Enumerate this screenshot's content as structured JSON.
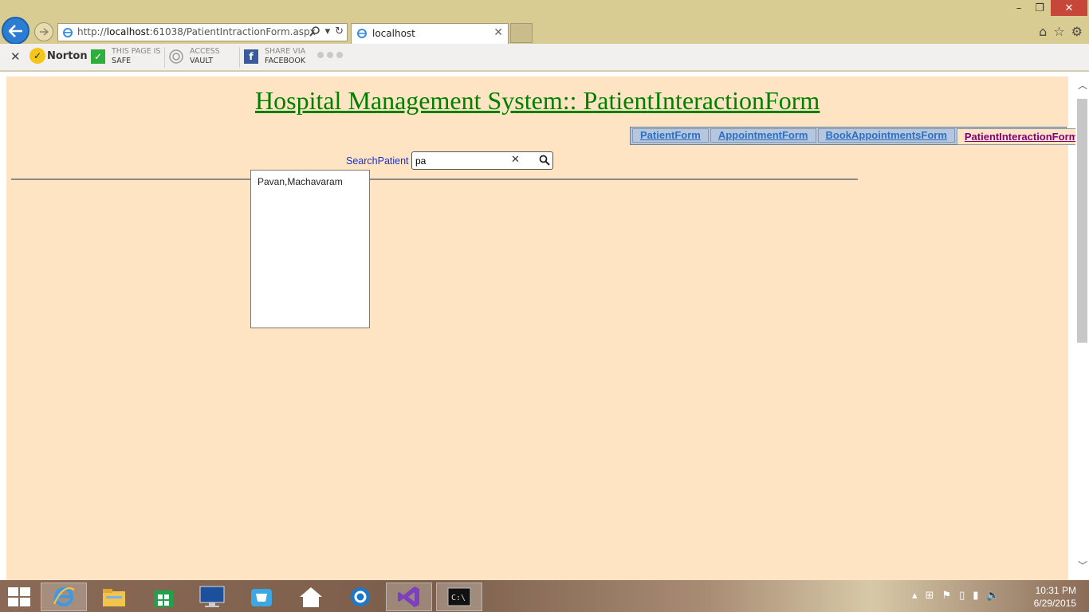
{
  "browser": {
    "url_prefix": "http://",
    "url_host": "localhost",
    "url_rest": ":61038/PatientIntractionForm.aspx",
    "tab_title": "localhost",
    "close_window": "✕",
    "minimize": "–",
    "restore": "❐"
  },
  "toolbar": {
    "brand": "Norton",
    "safe_line1": "THIS PAGE IS",
    "safe_line2": "SAFE",
    "vault_line1": "ACCESS",
    "vault_line2": "VAULT",
    "share_line1": "SHARE VIA",
    "share_line2": "FACEBOOK"
  },
  "page": {
    "title": "Hospital Management System:: PatientInteractionForm",
    "menu": [
      {
        "label": "PatientForm",
        "active": false
      },
      {
        "label": "AppointmentForm",
        "active": false
      },
      {
        "label": "BookAppointmentsForm",
        "active": false
      },
      {
        "label": "PatientInteractionForm",
        "active": true
      }
    ],
    "search_label": "SearchPatient",
    "search_value": "pa",
    "suggestions": [
      "Pavan,Machavaram"
    ]
  },
  "taskbar": {
    "time": "10:31 PM",
    "date": "6/29/2015",
    "apps": [
      "internet-explorer",
      "file-explorer",
      "store",
      "lenovo",
      "mail",
      "home",
      "browser-alt",
      "visual-studio",
      "command-prompt"
    ]
  },
  "colors": {
    "page_bg": "#ffe4c4",
    "title": "#008000",
    "menu_bg": "#b5c7de",
    "menu_link": "#2d6fc4",
    "menu_active": "#800080",
    "label": "#1a32cc"
  }
}
